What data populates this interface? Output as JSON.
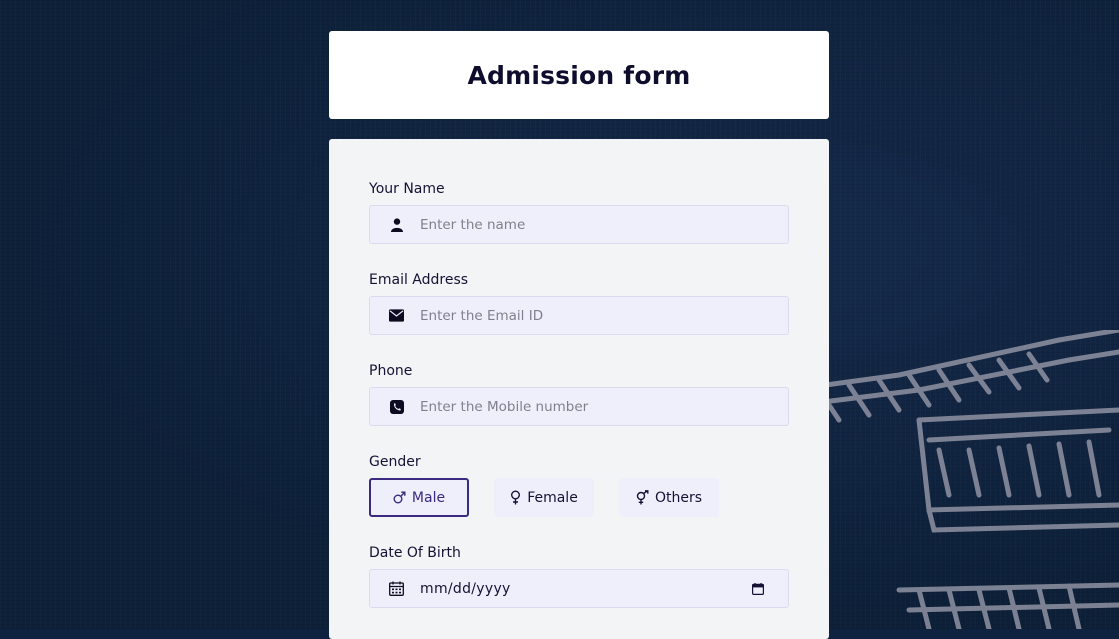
{
  "title": "Admission form",
  "fields": {
    "name": {
      "label": "Your Name",
      "placeholder": "Enter the name",
      "icon": "user-icon"
    },
    "email": {
      "label": "Email Address",
      "placeholder": "Enter the Email ID",
      "icon": "envelope-icon"
    },
    "phone": {
      "label": "Phone",
      "placeholder": "Enter the Mobile number",
      "icon": "phone-icon"
    },
    "gender": {
      "label": "Gender",
      "selected": "Male",
      "options": [
        {
          "label": "Male",
          "icon": "male-symbol-icon"
        },
        {
          "label": "Female",
          "icon": "female-symbol-icon"
        },
        {
          "label": "Others",
          "icon": "transgender-symbol-icon"
        }
      ]
    },
    "dob": {
      "label": "Date Of Birth",
      "value": "mm/dd/yyyy",
      "icon": "calendar-icon"
    }
  },
  "colors": {
    "background": "#0f2340",
    "card": "#f3f4f6",
    "input": "#efeffc",
    "accent": "#3b2a80",
    "text": "#151235"
  }
}
